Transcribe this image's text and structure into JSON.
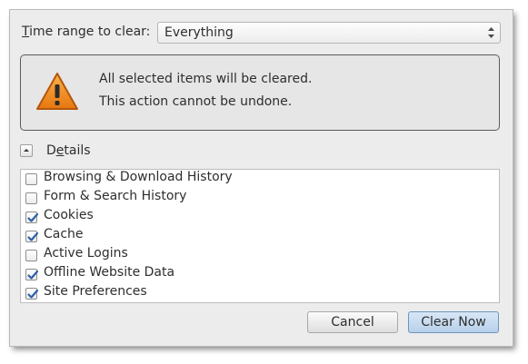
{
  "dialog": {
    "time_range": {
      "label_prefix": "T",
      "label_rest": "ime range to clear:",
      "selected": "Everything"
    },
    "warning": {
      "line1": "All selected items will be cleared.",
      "line2": "This action cannot be undone.",
      "icon": "warning-triangle-icon"
    },
    "details": {
      "label_pre": "D",
      "label_mnemonic": "e",
      "label_post": "tails",
      "expanded": true
    },
    "items": [
      {
        "label": "Browsing & Download History",
        "checked": false
      },
      {
        "label": "Form & Search History",
        "checked": false
      },
      {
        "label": "Cookies",
        "checked": true
      },
      {
        "label": "Cache",
        "checked": true
      },
      {
        "label": "Active Logins",
        "checked": false
      },
      {
        "label": "Offline Website Data",
        "checked": true
      },
      {
        "label": "Site Preferences",
        "checked": true
      }
    ],
    "buttons": {
      "cancel": "Cancel",
      "clear_now": "Clear Now"
    }
  },
  "colors": {
    "accent_button": "#b8d0ea",
    "check_blue": "#2e5fa8",
    "warning_orange": "#f08c1e"
  }
}
